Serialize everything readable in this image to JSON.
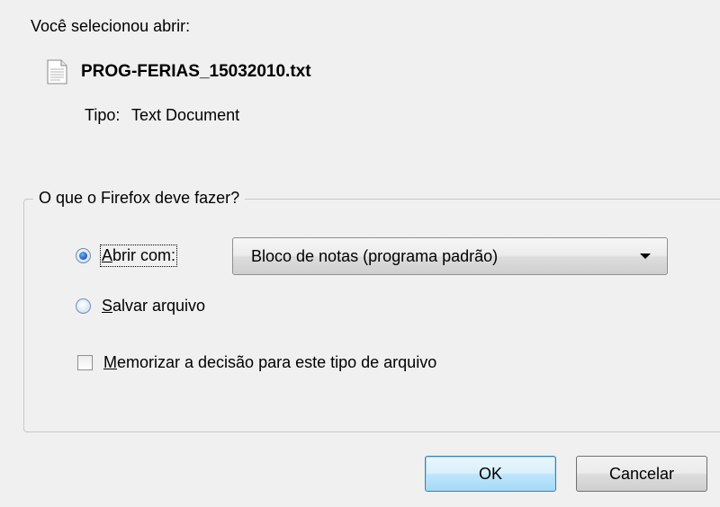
{
  "dialog": {
    "intro": "Você selecionou abrir:",
    "file": {
      "name": "PROG-FERIAS_15032010.txt",
      "icon": "text-file-icon"
    },
    "type": {
      "label": "Tipo:",
      "value": "Text Document"
    },
    "group": {
      "legend": "O que o Firefox deve fazer?",
      "open_with": {
        "mnemonic": "A",
        "rest": "brir com:",
        "checked": true
      },
      "open_with_select": {
        "value": "Bloco de notas (programa padrão)"
      },
      "save_file": {
        "mnemonic": "S",
        "rest": "alvar arquivo",
        "checked": false
      },
      "remember": {
        "mnemonic": "M",
        "rest": "emorizar a decisão para este tipo de arquivo",
        "checked": false
      }
    },
    "buttons": {
      "ok": "OK",
      "cancel": "Cancelar"
    }
  }
}
